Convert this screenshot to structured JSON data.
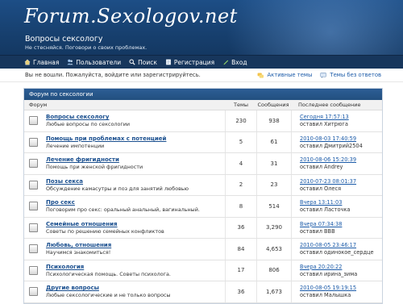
{
  "header": {
    "logo_text": "Forum.Sexologov.net",
    "site_title": "Вопросы сексологу",
    "site_description": "Не стесняйся. Поговори о своих проблемах."
  },
  "nav": {
    "items": [
      {
        "label": "Главная",
        "icon": "home-icon"
      },
      {
        "label": "Пользователи",
        "icon": "users-icon"
      },
      {
        "label": "Поиск",
        "icon": "search-icon"
      },
      {
        "label": "Регистрация",
        "icon": "register-icon"
      },
      {
        "label": "Вход",
        "icon": "login-icon"
      }
    ]
  },
  "notice": {
    "text": "Вы не вошли. Пожалуйста, войдите или зарегистрируйтесь.",
    "active_topics": "Активные темы",
    "unanswered": "Темы без ответов"
  },
  "panel": {
    "title": "Форум по сексологии",
    "columns": {
      "forum": "Форум",
      "topics": "Темы",
      "posts": "Сообщения",
      "last": "Последнее сообщение"
    },
    "rows": [
      {
        "title": "Вопросы сексологу",
        "desc": "Любые вопросы по сексологии",
        "topics": "230",
        "posts": "938",
        "last_date": "Сегодня 17:57:13",
        "last_by": "оставил Хитрюга"
      },
      {
        "title": "Помощь при проблемах с потенцией",
        "desc": "Лечение импотенции",
        "topics": "5",
        "posts": "61",
        "last_date": "2010-08-03 17:40:59",
        "last_by": "оставил Дмитрий2504"
      },
      {
        "title": "Лечение фригидности",
        "desc": "Помощь при женской фригидности",
        "topics": "4",
        "posts": "31",
        "last_date": "2010-08-06 15:20:39",
        "last_by": "оставил Andrey"
      },
      {
        "title": "Позы секса",
        "desc": "Обсуждение камасутры и поз для занятий любовью",
        "topics": "2",
        "posts": "23",
        "last_date": "2010-07-23 08:01:37",
        "last_by": "оставил Олеся"
      },
      {
        "title": "Про секс",
        "desc": "Поговорим про секс: оральный анальный, вагинальный.",
        "topics": "8",
        "posts": "514",
        "last_date": "Вчера 13:11:03",
        "last_by": "оставил Ласточка"
      },
      {
        "title": "Семейные отношения",
        "desc": "Советы по решению семейных конфликтов",
        "topics": "36",
        "posts": "3,290",
        "last_date": "Вчера 07:34:38",
        "last_by": "оставил BBB"
      },
      {
        "title": "Любовь, отношения",
        "desc": "Научимся знакомиться!",
        "topics": "84",
        "posts": "4,653",
        "last_date": "2010-08-05 23:46:17",
        "last_by": "оставил одинокое_сердце"
      },
      {
        "title": "Психология",
        "desc": "Психологическая помощь. Советы психолога.",
        "topics": "17",
        "posts": "806",
        "last_date": "Вчера 20:20:22",
        "last_by": "оставил ирина_зима"
      },
      {
        "title": "Другие вопросы",
        "desc": "Любые сексологические и не только вопросы",
        "topics": "36",
        "posts": "1,673",
        "last_date": "2010-08-05 19:19:15",
        "last_by": "оставил Малышка"
      }
    ]
  },
  "colors": {
    "header_bg": "#1d4e86",
    "nav_bg": "#17365c",
    "link": "#1a4f8f",
    "panel_head": "#2c5d95"
  }
}
